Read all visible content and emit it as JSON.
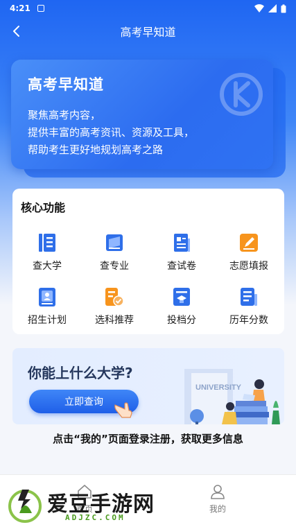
{
  "status": {
    "time": "4:21"
  },
  "nav": {
    "title": "高考早知道"
  },
  "hero": {
    "title": "高考早知道",
    "lines": [
      "聚焦高考内容，",
      "提供丰富的高考资讯、资源及工具，",
      "帮助考生更好地规划高考之路"
    ]
  },
  "functions": {
    "title": "核心功能",
    "items": [
      {
        "label": "查大学",
        "icon": "university-icon"
      },
      {
        "label": "查专业",
        "icon": "major-book-icon"
      },
      {
        "label": "查试卷",
        "icon": "exam-paper-icon"
      },
      {
        "label": "志愿填报",
        "icon": "application-pen-icon"
      },
      {
        "label": "招生计划",
        "icon": "enrollment-plan-icon"
      },
      {
        "label": "选科推荐",
        "icon": "subject-recommend-icon"
      },
      {
        "label": "投档分",
        "icon": "admission-score-icon"
      },
      {
        "label": "历年分数",
        "icon": "history-score-icon"
      }
    ]
  },
  "banner": {
    "title": "你能上什么大学?",
    "button": "立即查询",
    "sign": "UNIVERSITY"
  },
  "info_text": "点击“我的”页面登录注册，获取更多信息",
  "tabs": [
    {
      "label": "首页",
      "icon": "home-icon"
    },
    {
      "label": "我的",
      "icon": "user-icon"
    }
  ],
  "watermark": {
    "text": "爱豆手游网",
    "sub": "ADJZC.COM"
  },
  "colors": {
    "primary": "#2c6cf0",
    "icon_blue": "#2f6fe9",
    "icon_orange": "#f7941d"
  }
}
